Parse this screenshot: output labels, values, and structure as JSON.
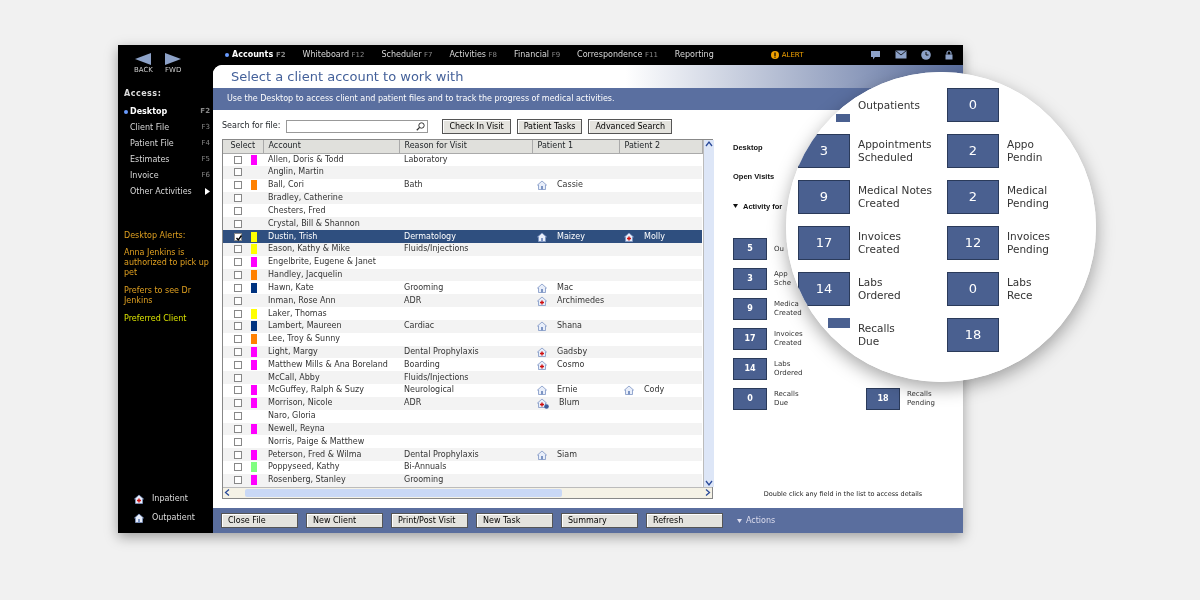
{
  "nav": {
    "back": "BACK",
    "forward": "FWD"
  },
  "menu": [
    {
      "label": "Accounts",
      "key": "F2",
      "selected": true
    },
    {
      "label": "Whiteboard",
      "key": "F12",
      "selected": false
    },
    {
      "label": "Scheduler",
      "key": "F7",
      "selected": false
    },
    {
      "label": "Activities",
      "key": "F8",
      "selected": false
    },
    {
      "label": "Financial",
      "key": "F9",
      "selected": false
    },
    {
      "label": "Correspondence",
      "key": "F11",
      "selected": false
    },
    {
      "label": "Reporting",
      "selected": false
    }
  ],
  "alert": "ALERT",
  "sidebar": {
    "heading": "Access:",
    "items": [
      {
        "label": "Desktop",
        "key": "F2",
        "selected": true
      },
      {
        "label": "Client File",
        "key": "F3",
        "selected": false
      },
      {
        "label": "Patient File",
        "key": "F4",
        "selected": false
      },
      {
        "label": "Estimates",
        "key": "F5",
        "selected": false
      },
      {
        "label": "Invoice",
        "key": "F6",
        "selected": false
      },
      {
        "label": "Other Activities",
        "kind": "submenu",
        "selected": false
      }
    ],
    "alerts_heading": "Desktop Alerts:",
    "alerts": [
      {
        "text": "Anna Jenkins is authorized to pick up pet",
        "kind": "note"
      },
      {
        "text": "Prefers to see Dr Jenkins",
        "kind": "note"
      },
      {
        "text": "Preferred Client",
        "kind": "status"
      }
    ],
    "legend": [
      {
        "label": "Inpatient",
        "kind": "inpatient"
      },
      {
        "label": "Outpatient",
        "kind": "outpatient"
      }
    ]
  },
  "header": {
    "title": "Select a client account to work with",
    "subtitle": "Use the Desktop to access client and patient files and to track the progress of medical activities."
  },
  "search": {
    "label": "Search for file:",
    "buttons": [
      "Check In Visit",
      "Patient Tasks",
      "Advanced Search"
    ]
  },
  "table": {
    "columns": [
      "Select",
      "Account",
      "Reason for Visit",
      "Patient 1",
      "Patient 2"
    ],
    "rows": [
      {
        "checked": false,
        "selected": false,
        "color": "#ff00ff",
        "account": "Allen, Doris & Todd",
        "reason": "Laboratory"
      },
      {
        "checked": false,
        "selected": false,
        "account": "Anglin, Martin"
      },
      {
        "checked": false,
        "selected": false,
        "color": "#ff8000",
        "account": "Ball, Cori",
        "reason": "Bath",
        "patient_1": {
          "name": "Cassie",
          "kind": "outpatient"
        }
      },
      {
        "checked": false,
        "selected": false,
        "account": "Bradley, Catherine"
      },
      {
        "checked": false,
        "selected": false,
        "account": "Chesters, Fred"
      },
      {
        "checked": false,
        "selected": false,
        "account": "Crystal, Bill & Shannon"
      },
      {
        "checked": true,
        "selected": true,
        "color": "#ffff00",
        "account": "Dustin, Trish",
        "reason": "Dermatology",
        "patient_1": {
          "name": "Maizey",
          "kind": "outpatient"
        },
        "patient_2": {
          "name": "Molly",
          "kind": "inpatient"
        }
      },
      {
        "checked": false,
        "selected": false,
        "color": "#ffff00",
        "account": "Eason, Kathy & Mike",
        "reason": "Fluids/Injections"
      },
      {
        "checked": false,
        "selected": false,
        "color": "#ff00ff",
        "account": "Engelbrite, Eugene & Janet"
      },
      {
        "checked": false,
        "selected": false,
        "color": "#ff8000",
        "account": "Handley, Jacquelin"
      },
      {
        "checked": false,
        "selected": false,
        "color": "#003380",
        "account": "Hawn, Kate",
        "reason": "Grooming",
        "patient_1": {
          "name": "Mac",
          "kind": "outpatient"
        }
      },
      {
        "checked": false,
        "selected": false,
        "account": "Inman, Rose Ann",
        "reason": "ADR",
        "patient_1": {
          "name": "Archimedes",
          "kind": "inpatient"
        }
      },
      {
        "checked": false,
        "selected": false,
        "color": "#ffff00",
        "account": "Laker, Thomas"
      },
      {
        "checked": false,
        "selected": false,
        "color": "#003380",
        "account": "Lambert, Maureen",
        "reason": "Cardiac",
        "patient_1": {
          "name": "Shana",
          "kind": "outpatient"
        }
      },
      {
        "checked": false,
        "selected": false,
        "color": "#ff8000",
        "account": "Lee, Troy & Sunny"
      },
      {
        "checked": false,
        "selected": false,
        "color": "#ff00ff",
        "account": "Light, Margy",
        "reason": "Dental Prophylaxis",
        "patient_1": {
          "name": "Gadsby",
          "kind": "inpatient"
        }
      },
      {
        "checked": false,
        "selected": false,
        "color": "#ff00ff",
        "account": "Matthew Mills & Ana Boreland",
        "reason": "Boarding",
        "patient_1": {
          "name": "Cosmo",
          "kind": "inpatient"
        }
      },
      {
        "checked": false,
        "selected": false,
        "account": "McCall, Abby",
        "reason": "Fluids/Injections"
      },
      {
        "checked": false,
        "selected": false,
        "color": "#ff00ff",
        "account": "McGuffey, Ralph & Suzy",
        "reason": "Neurological",
        "patient_1": {
          "name": "Ernie",
          "kind": "outpatient"
        },
        "patient_2": {
          "name": "Cody",
          "kind": "outpatient"
        }
      },
      {
        "checked": false,
        "selected": false,
        "color": "#ff00ff",
        "account": "Morrison, Nicole",
        "reason": "ADR",
        "patient_1": {
          "name": "Blum",
          "kind": "inpatient-note"
        }
      },
      {
        "checked": false,
        "selected": false,
        "account": "Naro, Gloria"
      },
      {
        "checked": false,
        "selected": false,
        "color": "#ff00ff",
        "account": "Newell, Reyna"
      },
      {
        "checked": false,
        "selected": false,
        "account": "Norris, Paige & Matthew"
      },
      {
        "checked": false,
        "selected": false,
        "color": "#ff00ff",
        "account": "Peterson, Fred & Wilma",
        "reason": "Dental Prophylaxis",
        "patient_1": {
          "name": "Siam",
          "kind": "outpatient"
        }
      },
      {
        "checked": false,
        "selected": false,
        "color": "#80ff80",
        "account": "Poppyseed, Kathy",
        "reason": "Bi-Annuals"
      },
      {
        "checked": false,
        "selected": false,
        "color": "#ff00ff",
        "account": "Rosenberg, Stanley",
        "reason": "Grooming"
      }
    ]
  },
  "panel": {
    "links": [
      {
        "label": "Desktop",
        "kind": "link"
      },
      {
        "label": "Open Visits",
        "kind": "link"
      },
      {
        "label": "Activity for",
        "kind": "section"
      }
    ],
    "tiles_left": [
      {
        "value": "5",
        "lines": [
          "Ou"
        ]
      },
      {
        "value": "3",
        "lines": [
          "App",
          "Sche"
        ]
      },
      {
        "value": "9",
        "lines": [
          "Medica",
          "Created"
        ]
      },
      {
        "value": "17",
        "lines": [
          "Invoices",
          "Created"
        ]
      },
      {
        "value": "14",
        "lines": [
          "Labs",
          "Ordered"
        ]
      },
      {
        "value": "0",
        "lines": [
          "Recalls",
          "Due"
        ]
      }
    ],
    "tiles_right": [
      {
        "value": "18",
        "lines": [
          "Recalls",
          "Pending"
        ]
      }
    ],
    "hint": "Double click any field in the list to access details"
  },
  "magnifier": {
    "left": [
      {
        "lines": [
          "Outpatients"
        ]
      },
      {
        "value": "3",
        "lines": [
          "Appointments",
          "Scheduled"
        ]
      },
      {
        "value": "9",
        "lines": [
          "Medical Notes",
          "Created"
        ]
      },
      {
        "value": "17",
        "lines": [
          "Invoices",
          "Created"
        ]
      },
      {
        "value": "14",
        "lines": [
          "Labs",
          "Ordered"
        ]
      },
      {
        "lines": [
          "Recalls",
          "Due"
        ]
      }
    ],
    "right": [
      {
        "value": "0"
      },
      {
        "value": "2",
        "lines": [
          "Appo",
          "Pendin"
        ]
      },
      {
        "value": "2",
        "lines": [
          "Medical",
          "Pending"
        ]
      },
      {
        "value": "12",
        "lines": [
          "Invoices",
          "Pending"
        ]
      },
      {
        "value": "0",
        "lines": [
          "Labs",
          "Rece"
        ]
      },
      {
        "value": "18"
      }
    ]
  },
  "bottom": {
    "buttons": [
      "Close File",
      "New Client",
      "Print/Post Visit",
      "New Task",
      "Summary",
      "Refresh"
    ],
    "actions": "Actions"
  }
}
